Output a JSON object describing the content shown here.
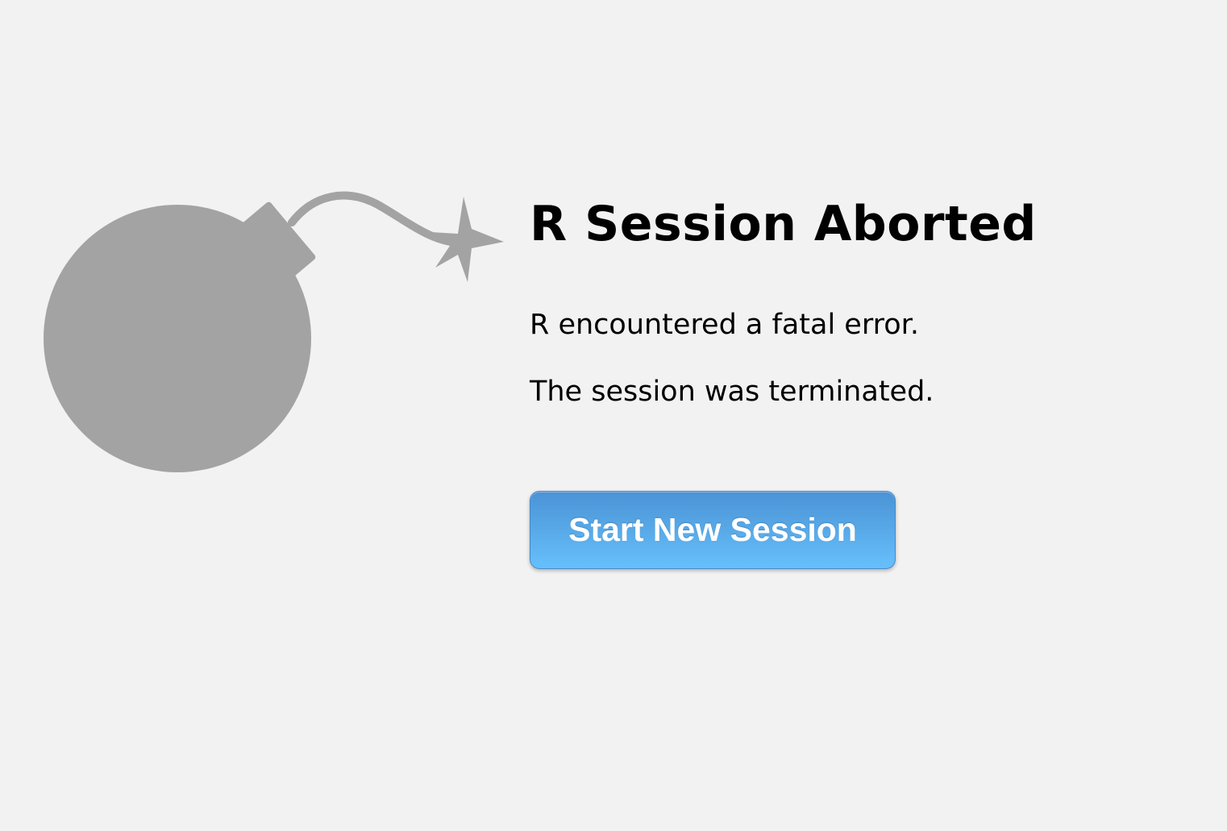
{
  "page": {
    "background": "#f2f2f2"
  },
  "illustration": {
    "icon": "bomb-icon",
    "color": "#a3a3a3"
  },
  "error": {
    "title": "R Session Aborted",
    "messages": [
      "R encountered a fatal error.",
      "The session was terminated."
    ]
  },
  "actions": {
    "start_new_session_label": "Start New Session",
    "button_color": "#58a9e8"
  }
}
